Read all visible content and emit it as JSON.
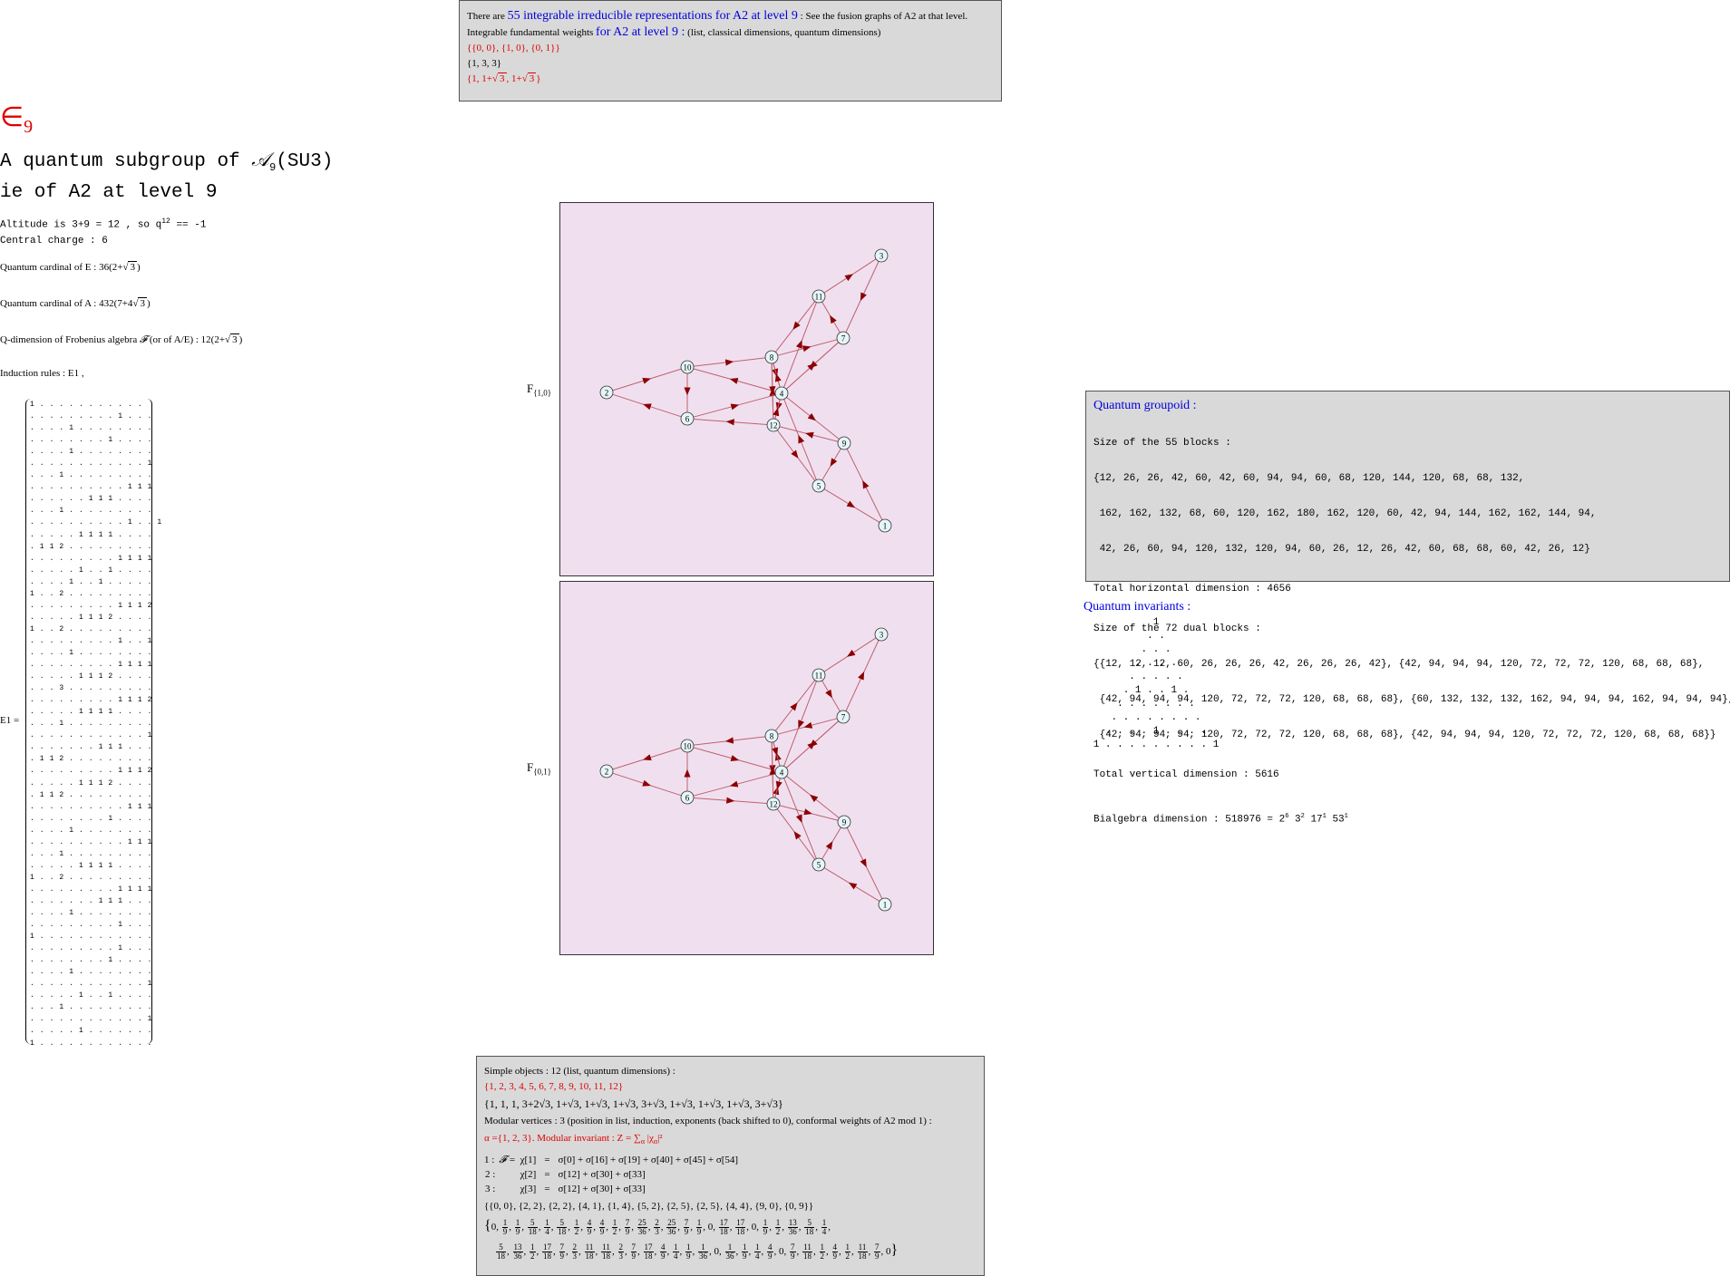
{
  "title_symbol": "∈",
  "title_subscript": "9",
  "heading1_pre": "A quantum subgroup of ",
  "heading1_script": "𝒜",
  "heading1_sub": "9",
  "heading1_post": "(SU3)",
  "heading2": "ie of A2 at level 9",
  "altitude_text": "Altitude is 3+9 = 12 , so q",
  "altitude_exp": "12",
  "altitude_tail": " == -1",
  "central_charge": "Central charge : 6",
  "qcard_E_label": "Quantum cardinal of E : ",
  "qcard_E_value_pre": "36(2+",
  "qcard_E_sqrt": "3",
  "qcard_A_label": "Quantum cardinal of A : ",
  "qcard_A_value_pre": "432(7+4",
  "qcard_A_sqrt": "3",
  "qdim_label": "Q-dimension of Frobenius algebra ",
  "qdim_script": "𝓕",
  "qdim_mid": " (or of A/E) : ",
  "qdim_value_pre": "12(2+",
  "qdim_sqrt": "3",
  "induction_rules": "Induction rules : E1 ,",
  "matrix_label": "E1 =",
  "matrix_rows": [
    "1 . . . . . . . . . . .",
    ". . . . . . . . . 1 . . .",
    ". . . . 1 . . . . . . . .",
    ". . . . . . . . 1 . . . .",
    ". . . . 1 . . . . . . . .",
    ". . . . . . . . . . . . 1",
    ". . . 1 . . . . . . . . .",
    ". . . . . . . . . . 1 1 1",
    ". . . . . . 1 1 1 . . . .",
    ". . . 1 . . . . . . . . .",
    ". . . . . . . . . . 1 . . 1",
    ". . . . . 1 1 1 1 . . . .",
    ". 1 1 2 . . . . . . . . .",
    ". . . . . . . . . 1 1 1 1",
    ". . . . . 1 . . 1 . . . .",
    ". . . . 1 . . 1 . . . . .",
    "1 . . 2 . . . . . . . . .",
    ". . . . . . . . . 1 1 1 2",
    ". . . . . 1 1 1 2 . . . .",
    "1 . . 2 . . . . . . . . .",
    ". . . . . . . . . 1 . . 1",
    ". . . . 1 . . . . . . . .",
    ". . . . . . . . . 1 1 1 1",
    ". . . . . 1 1 1 2 . . . .",
    ". . . 3 . . . . . . . . .",
    ". . . . . . . . . 1 1 1 2",
    ". . . . . 1 1 1 1 . . . .",
    ". . . 1 . . . . . . . . .",
    ". . . . . . . . . . . . 1",
    ". . . . . . . 1 1 1 . . .",
    ". 1 1 2 . . . . . . . . .",
    ". . . . . . . . . 1 1 1 2",
    ". . . . . 1 1 1 2 . . . .",
    ". 1 1 2 . . . . . . . . .",
    ". . . . . . . . . . 1 1 1",
    ". . . . . . . . 1 . . . .",
    ". . . . 1 . . . . . . . .",
    ". . . . . . . . . . 1 1 1",
    ". . . 1 . . . . . . . . .",
    ". . . . . 1 1 1 1 . . . .",
    "1 . . 2 . . . . . . . . .",
    ". . . . . . . . . 1 1 1 1",
    ". . . . . . . 1 1 1 . . .",
    ". . . . 1 . . . . . . . .",
    ". . . . . . . . . 1 . . .",
    "1 . . . . . . . . . . . .",
    ". . . . . . . . . 1 . . .",
    ". . . . . . . . 1 . . . .",
    ". . . . 1 . . . . . . . .",
    ". . . . . . . . . . . . 1",
    ". . . . . 1 . . 1 . . . .",
    ". . . 1 . . . . . . . . .",
    ". . . . . . . . . . . . 1",
    ". . . . . 1 . . . . . . .",
    "1 . . . . . . . . . . . ."
  ],
  "top_box": {
    "line1_pre": "There are ",
    "line1_link": "55 integrable irreducible representations for A2 at level 9",
    "line1_post": " : See the fusion graphs of A2 at that level.",
    "line2_pre": "Integrable fundamental weights ",
    "line2_link": "for A2 at level 9 :",
    "line2_post": "  (list, classical dimensions, quantum dimensions)",
    "weights": "{{0, 0}, {1, 0}, {0, 1}}",
    "classical_dims": "{1, 3, 3}",
    "quantum_dims_a": "{1, 1+",
    "quantum_dims_b": "3",
    "quantum_dims_c": ", 1+",
    "quantum_dims_d": "3",
    "quantum_dims_e": "}"
  },
  "graph1_label": "F",
  "graph1_sub": "{1,0}",
  "graph2_label": "F",
  "graph2_sub": "{0,1}",
  "graph_nodes": [
    {
      "id": "1"
    },
    {
      "id": "2"
    },
    {
      "id": "3"
    },
    {
      "id": "4"
    },
    {
      "id": "5"
    },
    {
      "id": "6"
    },
    {
      "id": "7"
    },
    {
      "id": "8"
    },
    {
      "id": "9"
    },
    {
      "id": "10"
    },
    {
      "id": "11"
    },
    {
      "id": "12"
    }
  ],
  "groupoid": {
    "title": "Quantum groupoid :",
    "size_blocks_label": "Size of the 55 blocks :",
    "size_blocks_lines": [
      "{12, 26, 26, 42, 60, 42, 60, 94, 94, 60, 68, 120, 144, 120, 68, 68, 132,",
      " 162, 162, 132, 68, 60, 120, 162, 180, 162, 120, 60, 42, 94, 144, 162, 162, 144, 94,",
      " 42, 26, 60, 94, 120, 132, 120, 94, 60, 26, 12, 26, 42, 60, 68, 68, 60, 42, 26, 12}"
    ],
    "total_horizontal": "Total horizontal dimension : 4656",
    "dual_blocks_label": "Size of the 72 dual blocks :",
    "dual_blocks_lines": [
      "{{12, 12, 12, 60, 26, 26, 26, 42, 26, 26, 26, 42}, {42, 94, 94, 94, 120, 72, 72, 72, 120, 68, 68, 68},",
      " {42, 94, 94, 94, 120, 72, 72, 72, 120, 68, 68, 68}, {60, 132, 132, 132, 162, 94, 94, 94, 162, 94, 94, 94},",
      " {42, 94, 94, 94, 120, 72, 72, 72, 120, 68, 68, 68}, {42, 94, 94, 94, 120, 72, 72, 72, 120, 68, 68, 68}}"
    ],
    "total_vertical": "Total vertical dimension : 5616",
    "bialgebra_pre": "Bialgebra dimension : 518976 = 2",
    "b_e1": "6",
    "b_m2": " 3",
    "b_e2": "2",
    "b_m3": " 17",
    "b_e3": "1",
    "b_m4": " 53",
    "b_e4": "1"
  },
  "invariants_title": "Quantum invariants :",
  "invariants_rows": [
    "1",
    ". .",
    ". . .",
    ". . . .",
    ". . . . .",
    ". 1 . . 1 .",
    ". . . . . . .",
    ". . . . . . . .",
    ". . . . 1 . . . .",
    "1 . . . . . . . . . 1"
  ],
  "simple_box": {
    "line1": "Simple objects : 12 (list, quantum dimensions) :",
    "list": "{1, 2, 3, 4, 5, 6, 7, 8, 9, 10, 11, 12}",
    "qdims": "{1, 1, 1, 3+2√3, 1+√3, 1+√3, 1+√3, 3+√3, 1+√3, 1+√3, 1+√3, 3+√3}",
    "modular_line": "Modular vertices : 3 (position in list, induction, exponents (back shifted to 0), conformal weights of A2 mod 1) :",
    "alpha_line": "α  ={1, 2, 3}.  Modular invariant :   Z = ∑",
    "alpha_sub": "α",
    "alpha_tail": " |χ",
    "alpha_sub2": "α",
    "alpha_end": "|²",
    "row1_idx": "1  : ",
    "row1_F": "𝓕 =",
    "row1_chi": "χ[1]",
    "row1_eq": "=",
    "row1_rhs": "σ[0] + σ[16] + σ[19] + σ[40] + σ[45] + σ[54]",
    "row2_idx": "2  :",
    "row2_chi": "χ[2]",
    "row2_eq": "=",
    "row2_rhs": "σ[12] + σ[30] + σ[33]",
    "row3_idx": "3  :",
    "row3_chi": "χ[3]",
    "row3_eq": "=",
    "row3_rhs": "σ[12] + σ[30] + σ[33]",
    "exponents": "{{0, 0}, {2, 2}, {2, 2}, {4, 1}, {1, 4}, {5, 2}, {2, 5}, {2, 5}, {4, 4}, {9, 0}, {0, 9}}",
    "cw_line1": [
      [
        "0"
      ],
      [
        "1",
        "9"
      ],
      [
        "1",
        "9"
      ],
      [
        "5",
        "18"
      ],
      [
        "1",
        "4"
      ],
      [
        "5",
        "18"
      ],
      [
        "1",
        "2"
      ],
      [
        "4",
        "9"
      ],
      [
        "4",
        "9"
      ],
      [
        "1",
        "2"
      ],
      [
        "7",
        "9"
      ],
      [
        "25",
        "36"
      ],
      [
        "2",
        "3"
      ],
      [
        "25",
        "36"
      ],
      [
        "7",
        "9"
      ],
      [
        "1",
        "9"
      ],
      [
        "0"
      ],
      [
        "17",
        "18"
      ],
      [
        "17",
        "18"
      ],
      [
        "0"
      ],
      [
        "1",
        "9"
      ],
      [
        "1",
        "2"
      ],
      [
        "13",
        "36"
      ],
      [
        "5",
        "18"
      ],
      [
        "1",
        "4"
      ]
    ],
    "cw_line2": [
      [
        "5",
        "18"
      ],
      [
        "13",
        "36"
      ],
      [
        "1",
        "2"
      ],
      [
        "17",
        "18"
      ],
      [
        "7",
        "9"
      ],
      [
        "2",
        "3"
      ],
      [
        "11",
        "18"
      ],
      [
        "11",
        "18"
      ],
      [
        "2",
        "3"
      ],
      [
        "7",
        "9"
      ],
      [
        "17",
        "18"
      ],
      [
        "4",
        "9"
      ],
      [
        "1",
        "4"
      ],
      [
        "1",
        "9"
      ],
      [
        "1",
        "36"
      ],
      [
        "0"
      ],
      [
        "1",
        "36"
      ],
      [
        "1",
        "9"
      ],
      [
        "1",
        "4"
      ],
      [
        "4",
        "9"
      ],
      [
        "0"
      ],
      [
        "7",
        "9"
      ],
      [
        "11",
        "18"
      ],
      [
        "1",
        "2"
      ],
      [
        "4",
        "9"
      ],
      [
        "1",
        "2"
      ],
      [
        "11",
        "18"
      ],
      [
        "7",
        "9"
      ],
      [
        "0"
      ]
    ]
  }
}
